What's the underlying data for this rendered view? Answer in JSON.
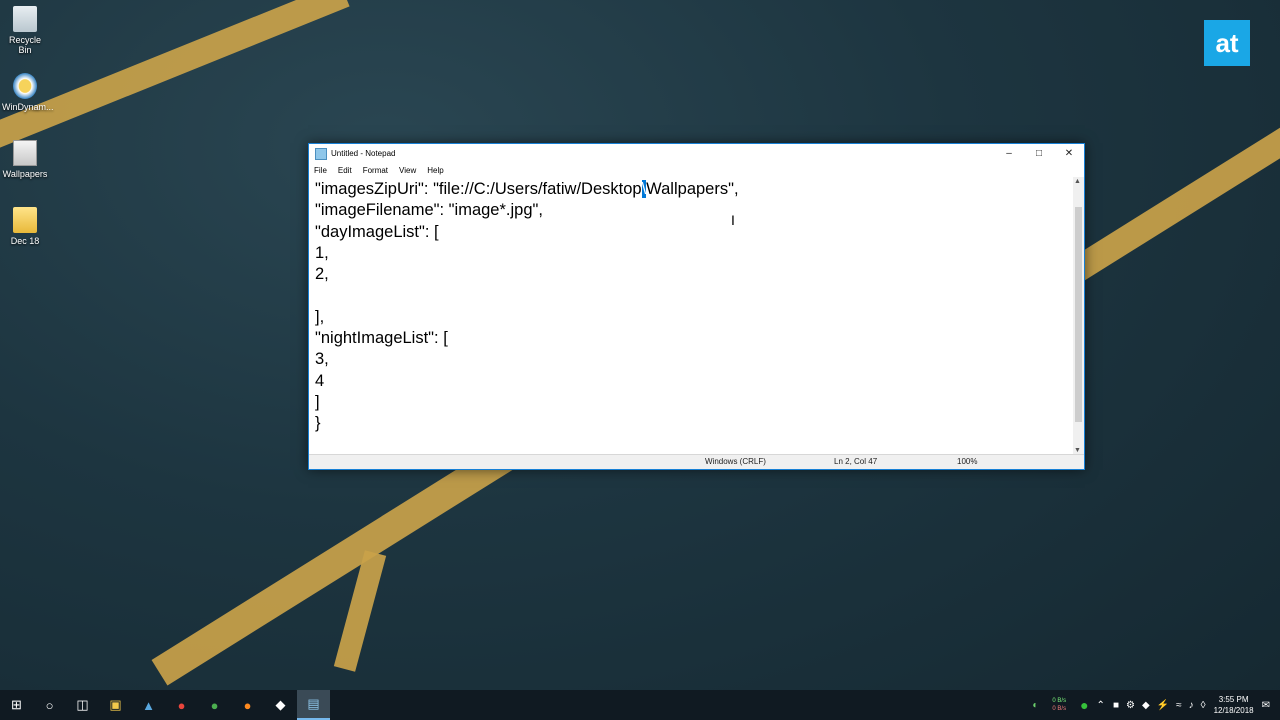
{
  "desktop": {
    "icons": [
      {
        "label": "Recycle Bin",
        "icon": "recycle-bin-icon"
      },
      {
        "label": "WinDynam...",
        "icon": "windynamic-icon"
      },
      {
        "label": "Wallpapers",
        "icon": "wallpapers-icon"
      },
      {
        "label": "Dec 18",
        "icon": "folder-icon"
      }
    ],
    "brand": "at",
    "colors": {
      "stripe": "#c9a24a",
      "brand": "#1aa7e6"
    }
  },
  "window": {
    "title": "Untitled - Notepad",
    "menu": [
      "File",
      "Edit",
      "Format",
      "View",
      "Help"
    ],
    "content": {
      "line1_before": "\"imagesZipUri\": \"file://C:/Users/fatiw/Desktop",
      "line1_selected": "\\",
      "line1_after": "Wallpapers\",",
      "lines": [
        "\"imageFilename\": \"image*.jpg\",",
        "\"dayImageList\": [",
        "1,",
        "2,",
        "",
        "],",
        "\"nightImageList\": [",
        "3,",
        "4",
        "]",
        "}"
      ]
    },
    "status": {
      "encoding": "Windows (CRLF)",
      "position": "Ln 2, Col 47",
      "zoom": "100%"
    }
  },
  "taskbar": {
    "items": [
      "start-icon",
      "search-icon",
      "task-view-icon",
      "file-explorer-icon",
      "app-icon",
      "chrome-icon",
      "chrome-alt-icon",
      "firefox-icon",
      "app-dark-icon",
      "notepad-icon"
    ],
    "net_up": "0 B/s",
    "net_down": "0 B/s",
    "time": "3:55 PM",
    "date": "12/18/2018"
  }
}
